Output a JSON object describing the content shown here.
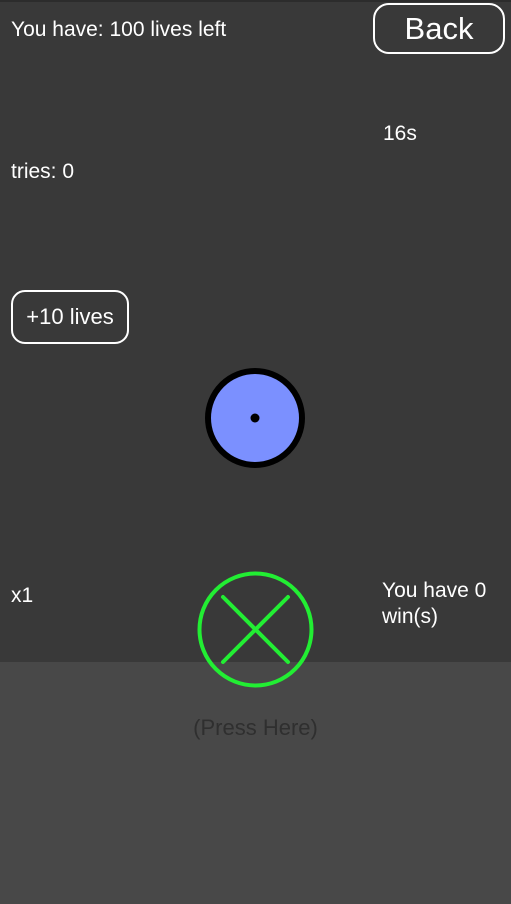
{
  "hud": {
    "lives_text": "You have: 100 lives left",
    "timer_text": "16s",
    "tries_text": "tries: 0",
    "multiplier_text": "x1",
    "wins_text": "You have 0 win(s)"
  },
  "buttons": {
    "back_label": "Back",
    "add_lives_label": "+10 lives"
  },
  "press_area": {
    "label": "(Press Here)"
  },
  "colors": {
    "background": "#393939",
    "press_area": "#484848",
    "ball_fill": "#7b90ff",
    "ball_outline": "#000000",
    "target_green": "#22ee33",
    "text": "#ffffff"
  },
  "icons": {
    "ball": "ball-icon",
    "target": "target-x-icon"
  }
}
